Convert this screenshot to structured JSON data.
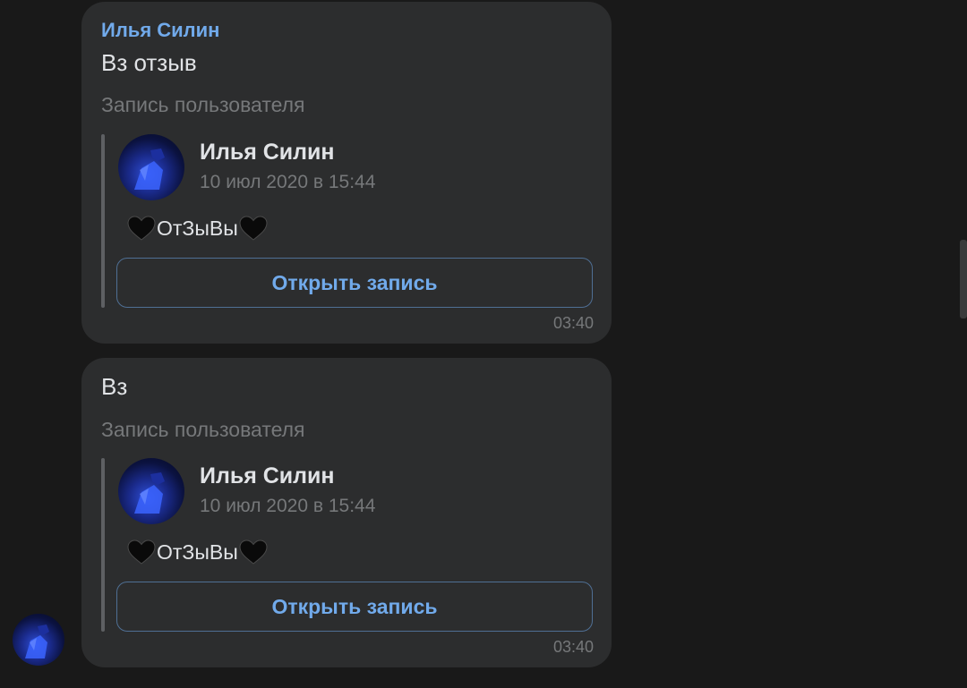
{
  "colors": {
    "background": "#191919",
    "bubble": "#2c2d2e",
    "accent": "#71aaeb",
    "text_primary": "#e1e3e6",
    "text_secondary": "#76787a"
  },
  "messages": [
    {
      "sender": "Илья Силин",
      "text": "Вз отзыв",
      "post_caption": "Запись пользователя",
      "post": {
        "author": "Илья Силин",
        "date": "10 июл 2020 в 15:44",
        "text": "ОтЗыВы",
        "emoji_icon": "black-heart-icon",
        "button_label": "Открыть запись"
      },
      "time": "03:40"
    },
    {
      "sender": "",
      "text": "Вз",
      "post_caption": "Запись пользователя",
      "post": {
        "author": "Илья Силин",
        "date": "10 июл 2020 в 15:44",
        "text": "ОтЗыВы",
        "emoji_icon": "black-heart-icon",
        "button_label": "Открыть запись"
      },
      "time": "03:40"
    }
  ]
}
